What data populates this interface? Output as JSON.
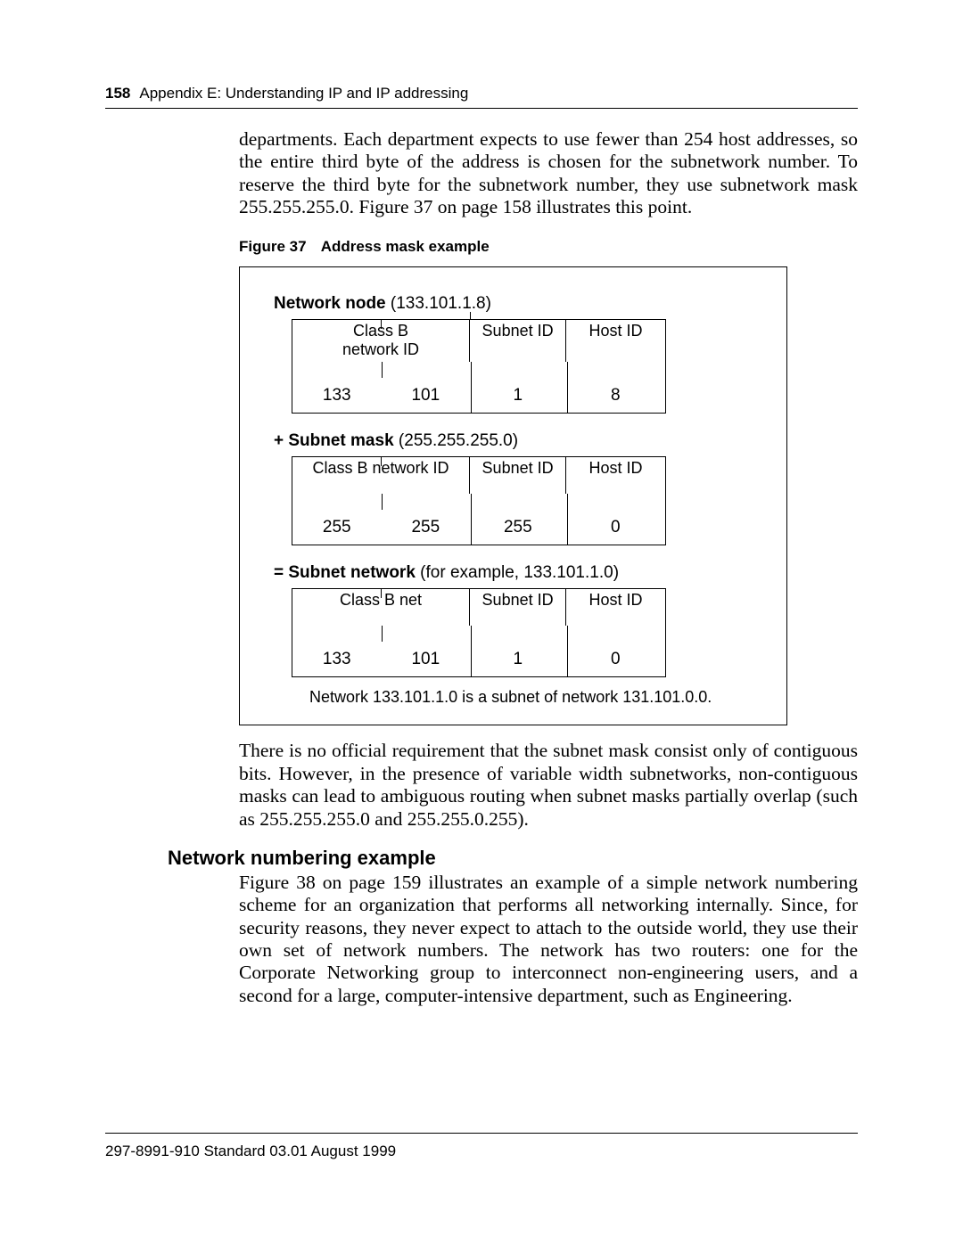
{
  "header": {
    "page_number": "158",
    "running_title": "Appendix E: Understanding IP and IP addressing"
  },
  "paragraph1": "departments. Each department expects to use fewer than 254 host addresses, so the entire third byte of the address is chosen for the subnetwork number. To reserve the third byte for the subnetwork number, they use subnetwork mask 255.255.255.0. Figure 37 on page 158 illustrates this point.",
  "figure37": {
    "label": "Figure 37",
    "caption": "Address mask example",
    "block1": {
      "title_bold": "Network node",
      "title_rest": " (133.101.1.8)",
      "hdr_net_l1": "Class B",
      "hdr_net_l2": "network ID",
      "hdr_sub": "Subnet ID",
      "hdr_host": "Host ID",
      "v1": "133",
      "v2": "101",
      "v3": "1",
      "v4": "8"
    },
    "block2": {
      "title_bold": "+ Subnet mask",
      "title_rest": " (255.255.255.0)",
      "hdr_net": "Class B network ID",
      "hdr_sub": "Subnet ID",
      "hdr_host": "Host ID",
      "v1": "255",
      "v2": "255",
      "v3": "255",
      "v4": "0"
    },
    "block3": {
      "title_bold": "= Subnet network",
      "title_rest": " (for example, 133.101.1.0)",
      "hdr_net": "Class B net",
      "hdr_sub": "Subnet ID",
      "hdr_host": "Host ID",
      "v1": "133",
      "v2": "101",
      "v3": "1",
      "v4": "0"
    },
    "footnote": "Network 133.101.1.0 is a subnet of network 131.101.0.0."
  },
  "paragraph2": "There is no official requirement that the subnet mask consist only of contiguous bits. However, in the presence of variable width subnetworks, non-contiguous masks can lead to ambiguous routing when subnet masks partially overlap (such as 255.255.255.0 and 255.255.0.255).",
  "section_heading": "Network numbering example",
  "paragraph3": "Figure 38 on page 159 illustrates an example of a simple network numbering scheme for an organization that performs all networking internally. Since, for security reasons, they never expect to attach to the outside world, they use their own set of network numbers. The network has two routers: one for the Corporate Networking group to interconnect non-engineering users, and a second for a large, computer-intensive department, such as Engineering.",
  "footer": "297-8991-910  Standard  03.01  August 1999"
}
